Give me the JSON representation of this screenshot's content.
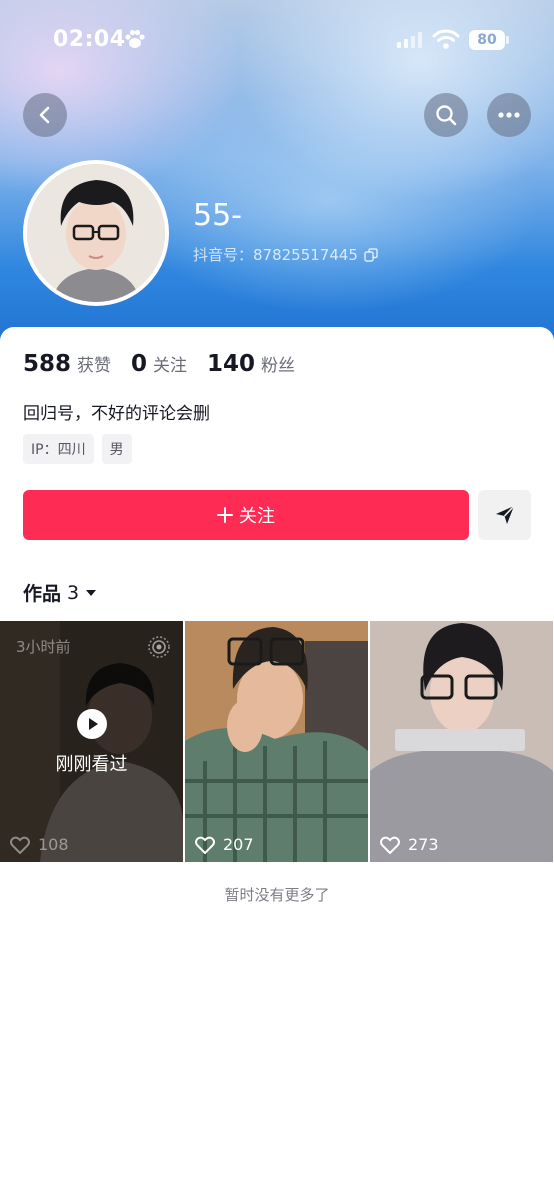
{
  "status_bar": {
    "time": "02:04",
    "battery": "80"
  },
  "header": {
    "nickname": "55-",
    "douyin_id_label": "抖音号：87825517445"
  },
  "stats": [
    {
      "number": "588",
      "label": "获赞"
    },
    {
      "number": "0",
      "label": "关注"
    },
    {
      "number": "140",
      "label": "粉丝"
    }
  ],
  "bio": "回归号，不好的评论会删",
  "tags": [
    "IP：四川",
    "男"
  ],
  "actions": {
    "follow_label": "关注"
  },
  "works": {
    "title": "作品",
    "count": "3",
    "items": [
      {
        "likes": "108",
        "time_ago": "3小时前",
        "overlay": "刚刚看过"
      },
      {
        "likes": "207"
      },
      {
        "likes": "273"
      }
    ]
  },
  "footer": {
    "no_more": "暂时没有更多了"
  },
  "colors": {
    "accent": "#fe2c55"
  }
}
